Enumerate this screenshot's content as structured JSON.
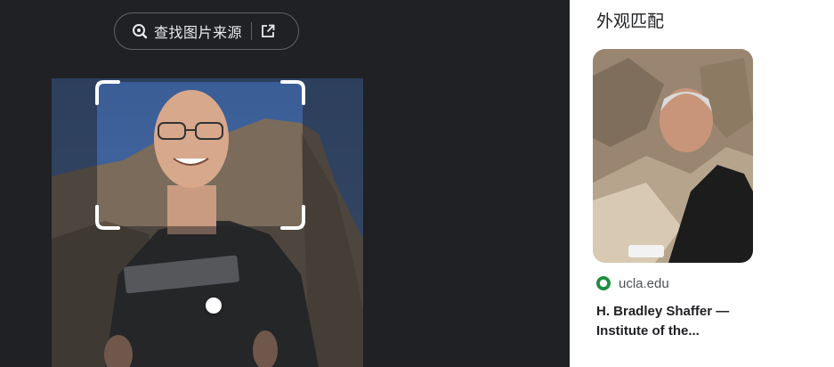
{
  "lens": {
    "find_source_label": "查找图片来源"
  },
  "results": {
    "section_title": "外观匹配",
    "items": [
      {
        "source": "ucla.edu",
        "title": "H. Bradley Shaffer — Institute of the..."
      }
    ]
  },
  "colors": {
    "dark_bg": "#202124",
    "source_favicon": "#1e8e3e"
  }
}
